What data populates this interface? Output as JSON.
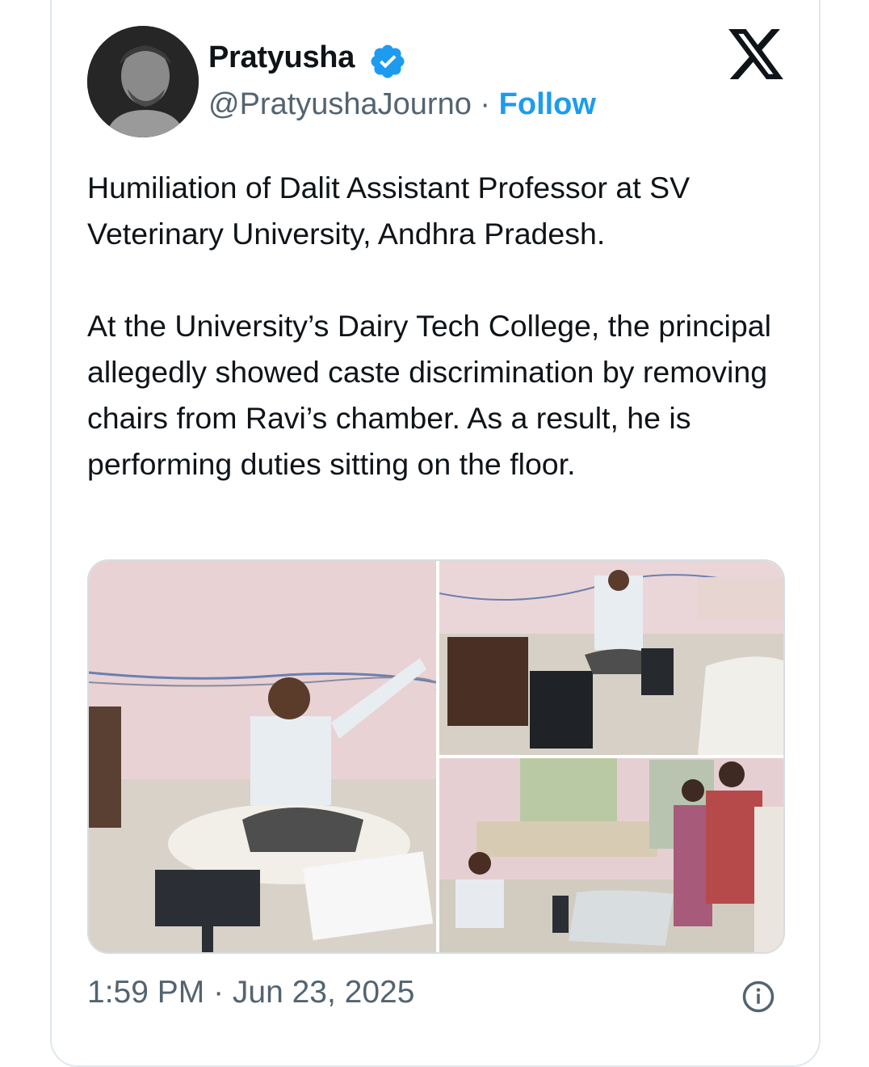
{
  "tweet": {
    "author": {
      "display_name": "Pratyusha",
      "handle": "@PratyushaJourno",
      "separator": "·",
      "follow_label": "Follow",
      "verified_icon": "verified-badge-icon"
    },
    "brand_icon": "x-logo-icon",
    "paragraphs": [
      "Humiliation of Dalit Assistant Professor at SV Veterinary University, Andhra Pradesh.",
      "At the University’s Dairy Tech College, the principal allegedly showed caste discrimination by removing chairs from Ravi’s chamber. As a result, he is performing duties sitting on the floor."
    ],
    "media_count": 3,
    "timestamp": "1:59 PM · Jun 23, 2025",
    "info_icon": "info-icon"
  },
  "colors": {
    "accent": "#1d9bf0",
    "secondary_text": "#536471",
    "primary_text": "#0f1419",
    "border": "#e1e8ed"
  }
}
